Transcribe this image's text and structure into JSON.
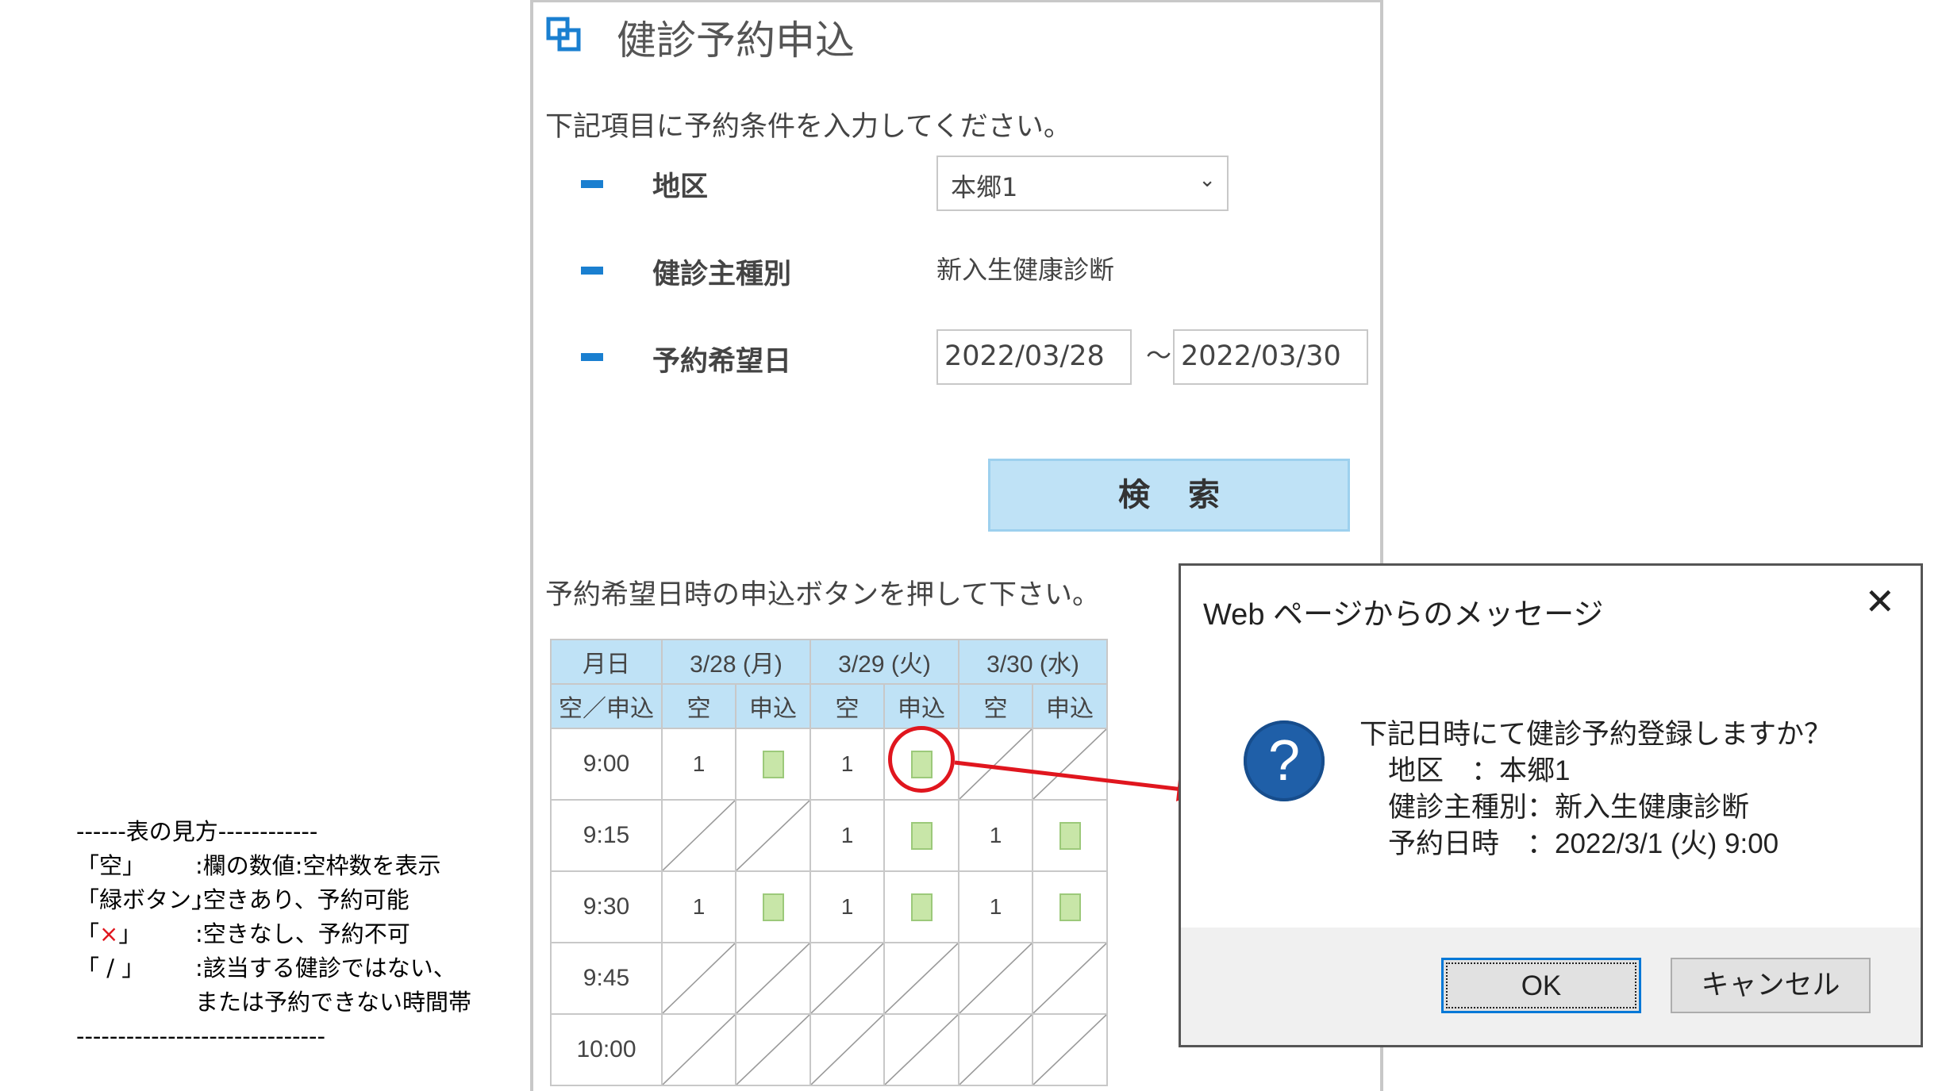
{
  "legend": {
    "header": "------表の見方------------",
    "rows": [
      {
        "key": "「空」",
        "desc": ":欄の数値:空枠数を表示"
      },
      {
        "key": "「緑ボタン」",
        "desc": ":空きあり、予約可能"
      },
      {
        "key_open": "「",
        "key_mark": "×",
        "key_close": "」",
        "desc": ":空きなし、予約不可"
      },
      {
        "key": "「 / 」",
        "desc": ":該当する健診ではない、"
      }
    ],
    "continuation": "または予約できない時間帯",
    "footer": "------------------------------"
  },
  "form": {
    "title": "健診予約申込",
    "intro": "下記項目に予約条件を入力してください。",
    "district_label": "地区",
    "district_value": "本郷1",
    "type_label": "健診主種別",
    "type_value": "新入生健康診断",
    "date_label": "予約希望日",
    "date_from": "2022/03/28",
    "date_sep": "～",
    "date_to": "2022/03/30",
    "search_label": "検索",
    "instruction": "予約希望日時の申込ボタンを押して下さい。"
  },
  "schedule": {
    "col_header": "月日",
    "sub_header": "空／申込",
    "days": [
      "3/28 (月)",
      "3/29 (火)",
      "3/30 (水)"
    ],
    "empty_label": "空",
    "apply_label": "申込",
    "rows": [
      {
        "time": "9:00",
        "cells": [
          [
            "1",
            "btn"
          ],
          [
            "1",
            "btn"
          ],
          [
            "/",
            "/"
          ]
        ]
      },
      {
        "time": "9:15",
        "cells": [
          [
            "/",
            "/"
          ],
          [
            "1",
            "btn"
          ],
          [
            "1",
            "btn"
          ]
        ]
      },
      {
        "time": "9:30",
        "cells": [
          [
            "1",
            "btn"
          ],
          [
            "1",
            "btn"
          ],
          [
            "1",
            "btn"
          ]
        ]
      },
      {
        "time": "9:45",
        "cells": [
          [
            "/",
            "/"
          ],
          [
            "/",
            "/"
          ],
          [
            "/",
            "/"
          ]
        ]
      },
      {
        "time": "10:00",
        "cells": [
          [
            "/",
            "/"
          ],
          [
            "/",
            "/"
          ],
          [
            "/",
            "/"
          ]
        ]
      }
    ]
  },
  "dialog": {
    "title": "Web ページからのメッセージ",
    "close": "✕",
    "icon": "?",
    "question": "下記日時にて健診予約登録しますか？",
    "line_district": "地区　：本郷1",
    "line_type": "健診主種別：新入生健康診断",
    "line_datetime": "予約日時　：2022/3/1 (火) 9:00",
    "ok_label": "OK",
    "cancel_label": "キャンセル"
  },
  "colors": {
    "accent_blue": "#1a7fd0",
    "header_bg": "#bfe2f6",
    "apply_button": "#c8e6a8",
    "highlight_red": "#e0161e",
    "dialog_icon": "#1f5fa8"
  }
}
